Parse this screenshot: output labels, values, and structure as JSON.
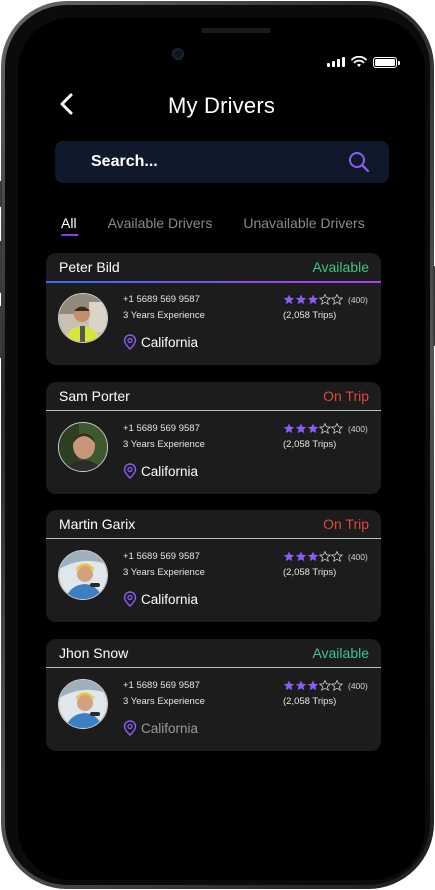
{
  "header": {
    "title": "My Drivers"
  },
  "search": {
    "placeholder": "Search..."
  },
  "tabs": [
    {
      "label": "All",
      "active": true
    },
    {
      "label": "Available Drivers",
      "active": false
    },
    {
      "label": "Unavailable Drivers",
      "active": false
    }
  ],
  "drivers": [
    {
      "name": "Peter Bild",
      "status": "Available",
      "phone": "+1 5689 569 9587",
      "experience": "3 Years Experience",
      "reviews": "(400)",
      "trips": "(2,058 Trips)",
      "location": "California",
      "rating": 3
    },
    {
      "name": "Sam Porter",
      "status": "On Trip",
      "phone": "+1 5689 569 9587",
      "experience": "3 Years Experience",
      "reviews": "(400)",
      "trips": "(2,058 Trips)",
      "location": "California",
      "rating": 3
    },
    {
      "name": "Martin Garix",
      "status": "On Trip",
      "phone": "+1 5689 569 9587",
      "experience": "3 Years Experience",
      "reviews": "(400)",
      "trips": "(2,058 Trips)",
      "location": "California",
      "rating": 3
    },
    {
      "name": "Jhon Snow",
      "status": "Available",
      "phone": "+1 5689 569 9587",
      "experience": "3 Years Experience",
      "reviews": "(400)",
      "trips": "(2,058 Trips)",
      "location": "California",
      "rating": 3
    }
  ],
  "colors": {
    "available": "#3ec48a",
    "on_trip": "#e04a3a",
    "accent": "#8b5cf6",
    "search_bg": "#10192b",
    "card_bg": "#1c1c1c"
  },
  "icons": [
    "back-arrow-icon",
    "search-icon",
    "location-pin-icon",
    "star-icon",
    "signal-icon",
    "wifi-icon",
    "battery-icon"
  ]
}
